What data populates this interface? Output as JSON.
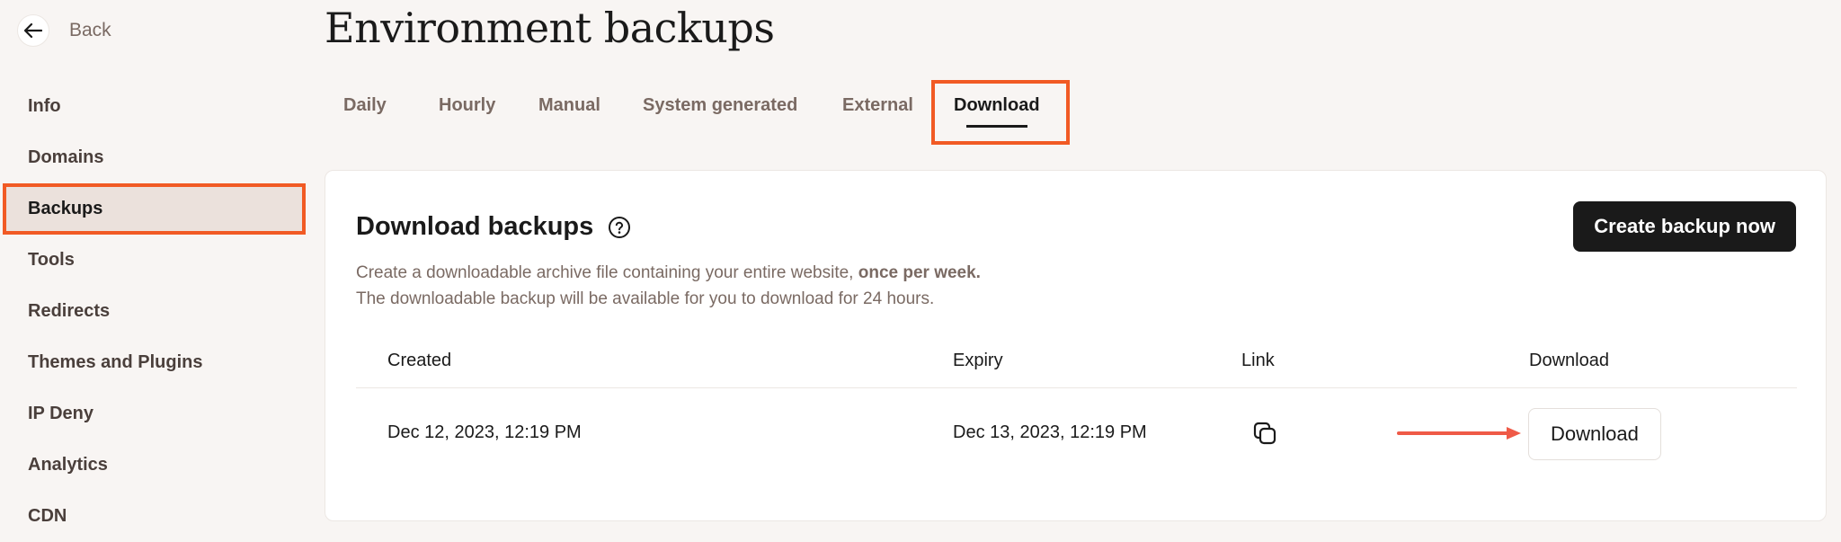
{
  "nav": {
    "back_label": "Back"
  },
  "sidebar": {
    "items": [
      {
        "label": "Info"
      },
      {
        "label": "Domains"
      },
      {
        "label": "Backups"
      },
      {
        "label": "Tools"
      },
      {
        "label": "Redirects"
      },
      {
        "label": "Themes and Plugins"
      },
      {
        "label": "IP Deny"
      },
      {
        "label": "Analytics"
      },
      {
        "label": "CDN"
      }
    ],
    "active": "Backups"
  },
  "page": {
    "title": "Environment backups"
  },
  "tabs": {
    "items": [
      {
        "label": "Daily"
      },
      {
        "label": "Hourly"
      },
      {
        "label": "Manual"
      },
      {
        "label": "System generated"
      },
      {
        "label": "External"
      },
      {
        "label": "Download"
      }
    ],
    "active": "Download"
  },
  "card": {
    "title": "Download backups",
    "desc_line1": "Create a downloadable archive file containing your entire website,",
    "desc_line1_bold": "once per week.",
    "desc_line2": "The downloadable backup will be available for you to download for 24 hours.",
    "create_button": "Create backup now"
  },
  "table": {
    "headers": {
      "created": "Created",
      "expiry": "Expiry",
      "link": "Link",
      "download": "Download"
    },
    "rows": [
      {
        "created": "Dec 12, 2023, 12:19 PM",
        "expiry": "Dec 13, 2023, 12:19 PM",
        "download_button": "Download"
      }
    ]
  },
  "colors": {
    "highlight": "#f15a24",
    "arrow": "#ef5a47",
    "primary_button": "#1a1a1a",
    "muted_text": "#7a6a63",
    "background": "#f8f5f3"
  }
}
